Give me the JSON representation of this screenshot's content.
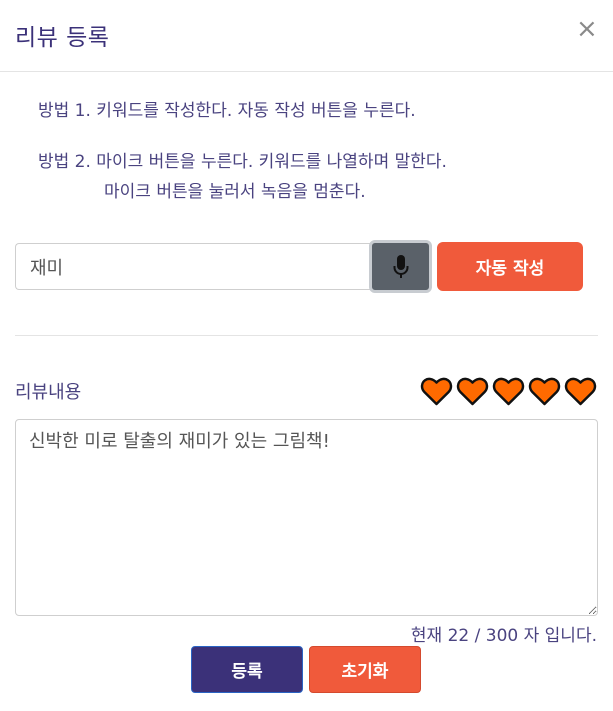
{
  "modal": {
    "title": "리뷰 등록",
    "close_symbol": "×"
  },
  "instructions": {
    "line1": "방법 1. 키워드를 작성한다. 자동 작성 버튼을 누른다.",
    "line2": "방법 2. 마이크 버튼을 누른다. 키워드를 나열하며 말한다.",
    "line3": "마이크 버튼을 눌러서 녹음을 멈춘다."
  },
  "keyword": {
    "value": "재미",
    "mic_icon": "microphone-icon",
    "auto_button_label": "자동 작성"
  },
  "review": {
    "label": "리뷰내용",
    "rating": {
      "value": 5,
      "max": 5,
      "icon": "heart-icon",
      "color": "#ff6a00"
    },
    "content": "신박한 미로 탈출의 재미가 있는 그림책!",
    "counter_text": "현재 22 / 300 자 입니다."
  },
  "actions": {
    "submit_label": "등록",
    "reset_label": "초기화"
  },
  "colors": {
    "primary": "#3b3179",
    "accent": "#f05a3b",
    "mic_bg": "#5a6169"
  }
}
